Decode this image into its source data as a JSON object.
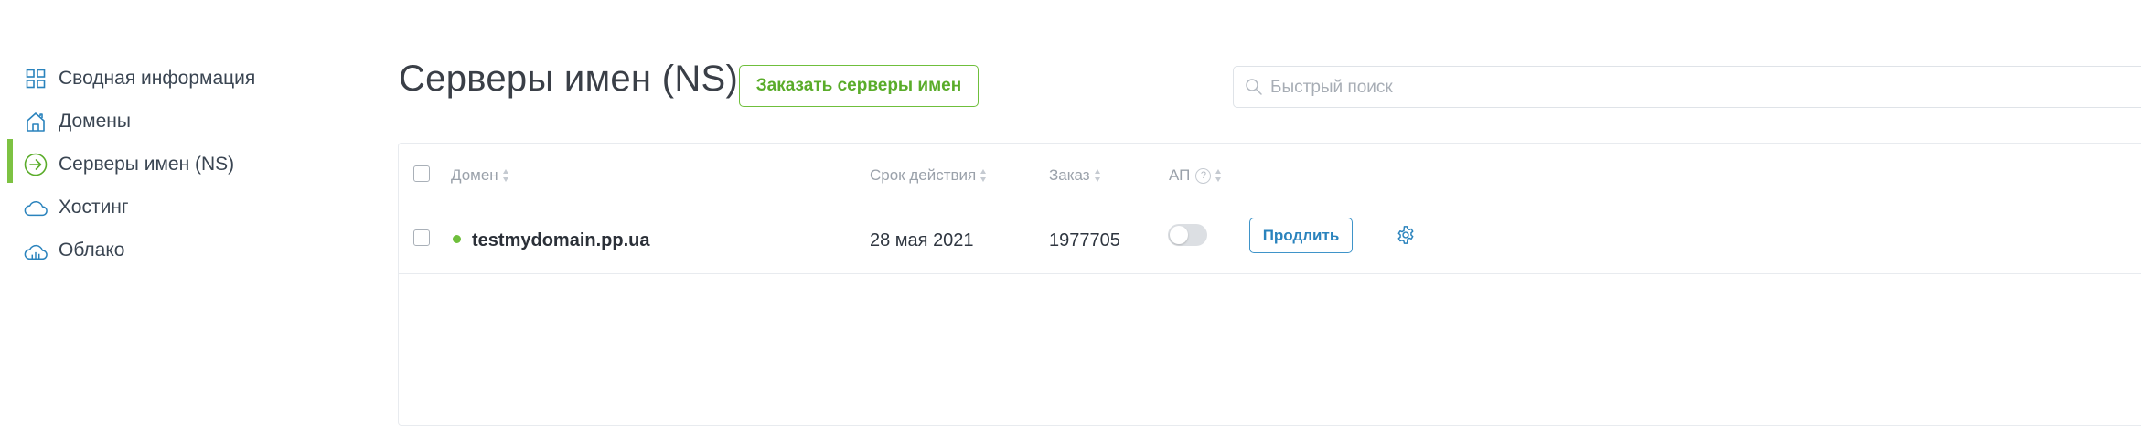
{
  "sidebar": {
    "items": [
      {
        "label": "Сводная информация",
        "icon": "grid-icon"
      },
      {
        "label": "Домены",
        "icon": "home-icon"
      },
      {
        "label": "Серверы имен (NS)",
        "icon": "arrow-circle-icon",
        "active": true
      },
      {
        "label": "Хостинг",
        "icon": "cloud-icon"
      },
      {
        "label": "Облако",
        "icon": "cloud-chart-icon"
      }
    ]
  },
  "header": {
    "title": "Серверы имен (NS)",
    "order_button": "Заказать серверы имен",
    "search_placeholder": "Быстрый поиск"
  },
  "table": {
    "columns": {
      "domain": "Домен",
      "expiry": "Срок действия",
      "order": "Заказ",
      "ap": "АП",
      "ap_help": "?"
    },
    "rows": [
      {
        "domain": "testmydomain.pp.ua",
        "status": "active",
        "expiry": "28 мая 2021",
        "order": "1977705",
        "autorenew": false,
        "action": "Продлить"
      }
    ]
  },
  "colors": {
    "accent_green": "#6fbf3c",
    "accent_blue": "#3f94c9",
    "icon_blue": "#2a83bd"
  }
}
